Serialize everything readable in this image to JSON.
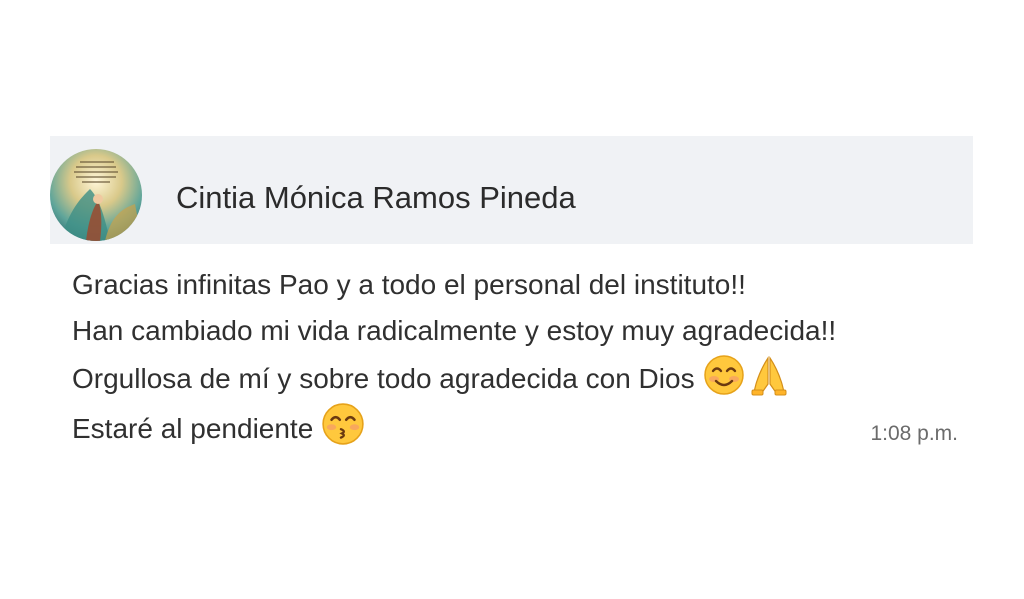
{
  "contact": {
    "name": "Cintia Mónica Ramos Pineda"
  },
  "message": {
    "lines": [
      "Gracias infinitas Pao y a todo el personal del instituto!!",
      "Han cambiado mi vida radicalmente y estoy muy agradecida!!",
      "Orgullosa de mí y sobre todo agradecida con Dios",
      "Estaré al pendiente"
    ],
    "emojis": {
      "line3": [
        "smiling-face-with-smiling-eyes-icon",
        "folded-hands-icon"
      ],
      "line4": [
        "kissing-face-with-smiling-eyes-icon"
      ]
    },
    "time": "1:08 p.m."
  },
  "colors": {
    "header_bg": "#f0f2f5",
    "bubble_bg": "#ffffff",
    "name_text": "#2b2b2b",
    "message_text": "#303030",
    "timestamp_text": "#6b6b6b",
    "emoji_face": "#ffc83d"
  }
}
